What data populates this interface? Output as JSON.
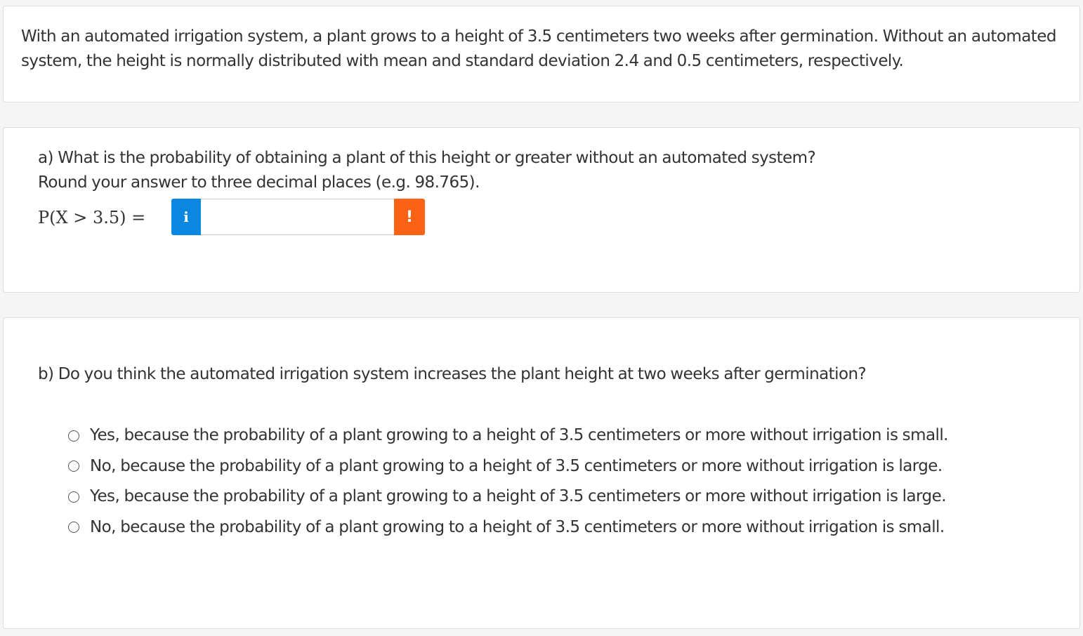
{
  "intro": {
    "text": "With an automated irrigation system, a plant grows to a height of 3.5 centimeters two weeks after germination. Without an automated system, the height is normally distributed with mean and standard deviation 2.4 and 0.5 centimeters, respectively."
  },
  "part_a": {
    "question": "a) What is the probability of obtaining a plant of this height or greater without an automated system?",
    "instruction": "Round your answer to three decimal places (e.g. 98.765).",
    "math_label": "P(X > 3.5) =",
    "info_icon": "i",
    "warning_icon": "!",
    "answer_value": "",
    "colors": {
      "info": "#0a87e0",
      "warning": "#fc6215"
    }
  },
  "part_b": {
    "question": "b) Do you think the automated irrigation system increases the plant height at two weeks after germination?",
    "options": [
      {
        "label": "Yes, because the probability of a plant growing to a height of 3.5 centimeters or more without irrigation is small.",
        "selected": false
      },
      {
        "label": "No, because the probability of a plant growing to a height of 3.5 centimeters or more without irrigation is large.",
        "selected": false
      },
      {
        "label": "Yes, because the probability of a plant growing to a height of 3.5 centimeters or more without irrigation is large.",
        "selected": false
      },
      {
        "label": "No, because the probability of a plant growing to a height of 3.5 centimeters or more without irrigation is small.",
        "selected": false
      }
    ]
  }
}
